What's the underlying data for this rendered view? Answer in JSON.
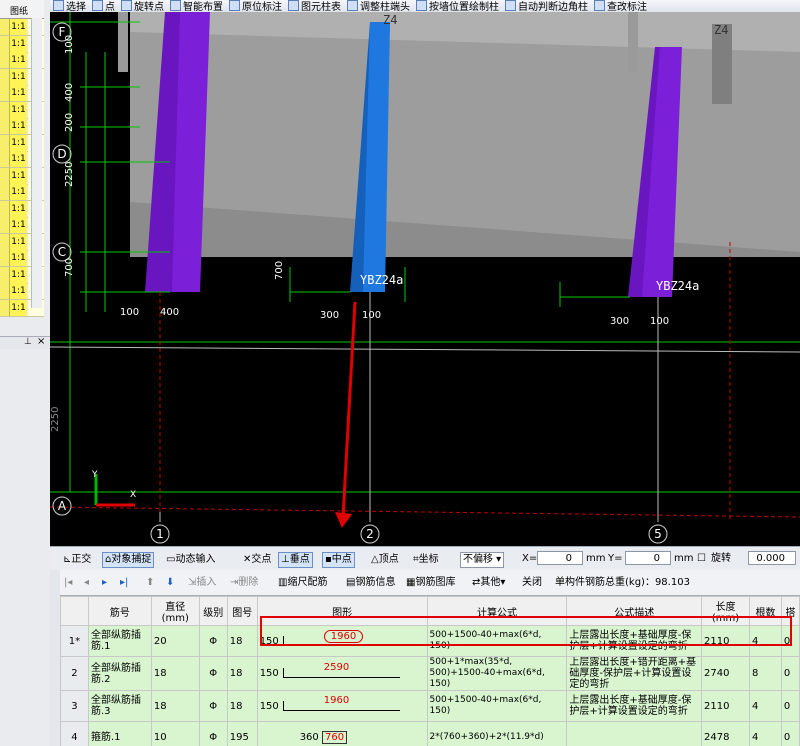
{
  "toolbar": {
    "items": [
      "选择",
      "点",
      "旋转点",
      "智能布置",
      "原位标注",
      "图元柱表",
      "调整柱端头",
      "按墙位置绘制柱",
      "自动判断边角柱",
      "查改标注"
    ]
  },
  "left_panel": {
    "header": "图纸",
    "rows": [
      "1:1",
      "1:1",
      "1:1",
      "1:1",
      "1:1",
      "1:1",
      "1:1",
      "1:1",
      "1:1",
      "1:1",
      "1:1",
      "1:1",
      "1:1",
      "1:1",
      "1:1",
      "1:1",
      "1:1",
      "1:1"
    ]
  },
  "viewport": {
    "axis_letters": [
      "F",
      "D",
      "C",
      "A"
    ],
    "axis_numbers": [
      "1",
      "2",
      "5"
    ],
    "column_labels": [
      "YBZ24a",
      "YBZ24a"
    ],
    "top_labels": [
      "Z4",
      "Z4"
    ],
    "dims_vertical": [
      "100",
      "400",
      "200",
      "2250",
      "700",
      "700",
      "2250"
    ],
    "dims_horizontal": [
      "100",
      "400",
      "300",
      "100",
      "300",
      "100"
    ],
    "colors": {
      "purple": "#7b1fd8",
      "blue": "#1f78e0",
      "grey": "#9b9b9b",
      "green": "#00c800"
    }
  },
  "snapbar": {
    "ortho": "正交",
    "obj_snap": "对象捕捉",
    "dyn_input": "动态输入",
    "intersect": "交点",
    "perp": "垂点",
    "mid": "中点",
    "vertex": "顶点",
    "coord": "坐标",
    "offset_mode": "不偏移",
    "x_label": "X=",
    "x_value": "0",
    "unit1": "mm",
    "y_label": "Y=",
    "y_value": "0",
    "unit2": "mm",
    "rotate_label": "旋转",
    "rotate_value": "0.000"
  },
  "rebarbar": {
    "insert": "插入",
    "delete": "删除",
    "scale": "缩尺配筋",
    "info": "钢筋信息",
    "library": "钢筋图库",
    "other": "其他",
    "close": "关闭",
    "total": "单构件钢筋总重(kg)：98.103"
  },
  "table": {
    "headers": [
      "",
      "筋号",
      "直径(mm)",
      "级别",
      "图号",
      "图形",
      "计算公式",
      "公式描述",
      "长度(mm)",
      "根数",
      "搭"
    ],
    "rows": [
      {
        "idx": "1*",
        "name": "全部纵筋插筋.1",
        "dia": "20",
        "grade": "Φ",
        "fig": "18",
        "left": "150",
        "mid": "1960",
        "formula": "500+1500-40+max(6*d, 150)",
        "desc": "上层露出长度+基础厚度-保护层+计算设置设定的弯折",
        "len": "2110",
        "count": "4",
        "lap": "0"
      },
      {
        "idx": "2",
        "name": "全部纵筋插筋.2",
        "dia": "18",
        "grade": "Φ",
        "fig": "18",
        "left": "150",
        "mid": "2590",
        "formula": "500+1*max(35*d, 500)+1500-40+max(6*d, 150)",
        "desc": "上层露出长度+错开距离+基础厚度-保护层+计算设置设定的弯折",
        "len": "2740",
        "count": "8",
        "lap": "0"
      },
      {
        "idx": "3",
        "name": "全部纵筋插筋.3",
        "dia": "18",
        "grade": "Φ",
        "fig": "18",
        "left": "150",
        "mid": "1960",
        "formula": "500+1500-40+max(6*d, 150)",
        "desc": "上层露出长度+基础厚度-保护层+计算设置设定的弯折",
        "len": "2110",
        "count": "4",
        "lap": "0"
      },
      {
        "idx": "4",
        "name": "箍筋.1",
        "dia": "10",
        "grade": "Φ",
        "fig": "195",
        "left": "360",
        "mid": "760",
        "formula": "2*(760+360)+2*(11.9*d)",
        "desc": "",
        "len": "2478",
        "count": "4",
        "lap": "0"
      }
    ]
  }
}
